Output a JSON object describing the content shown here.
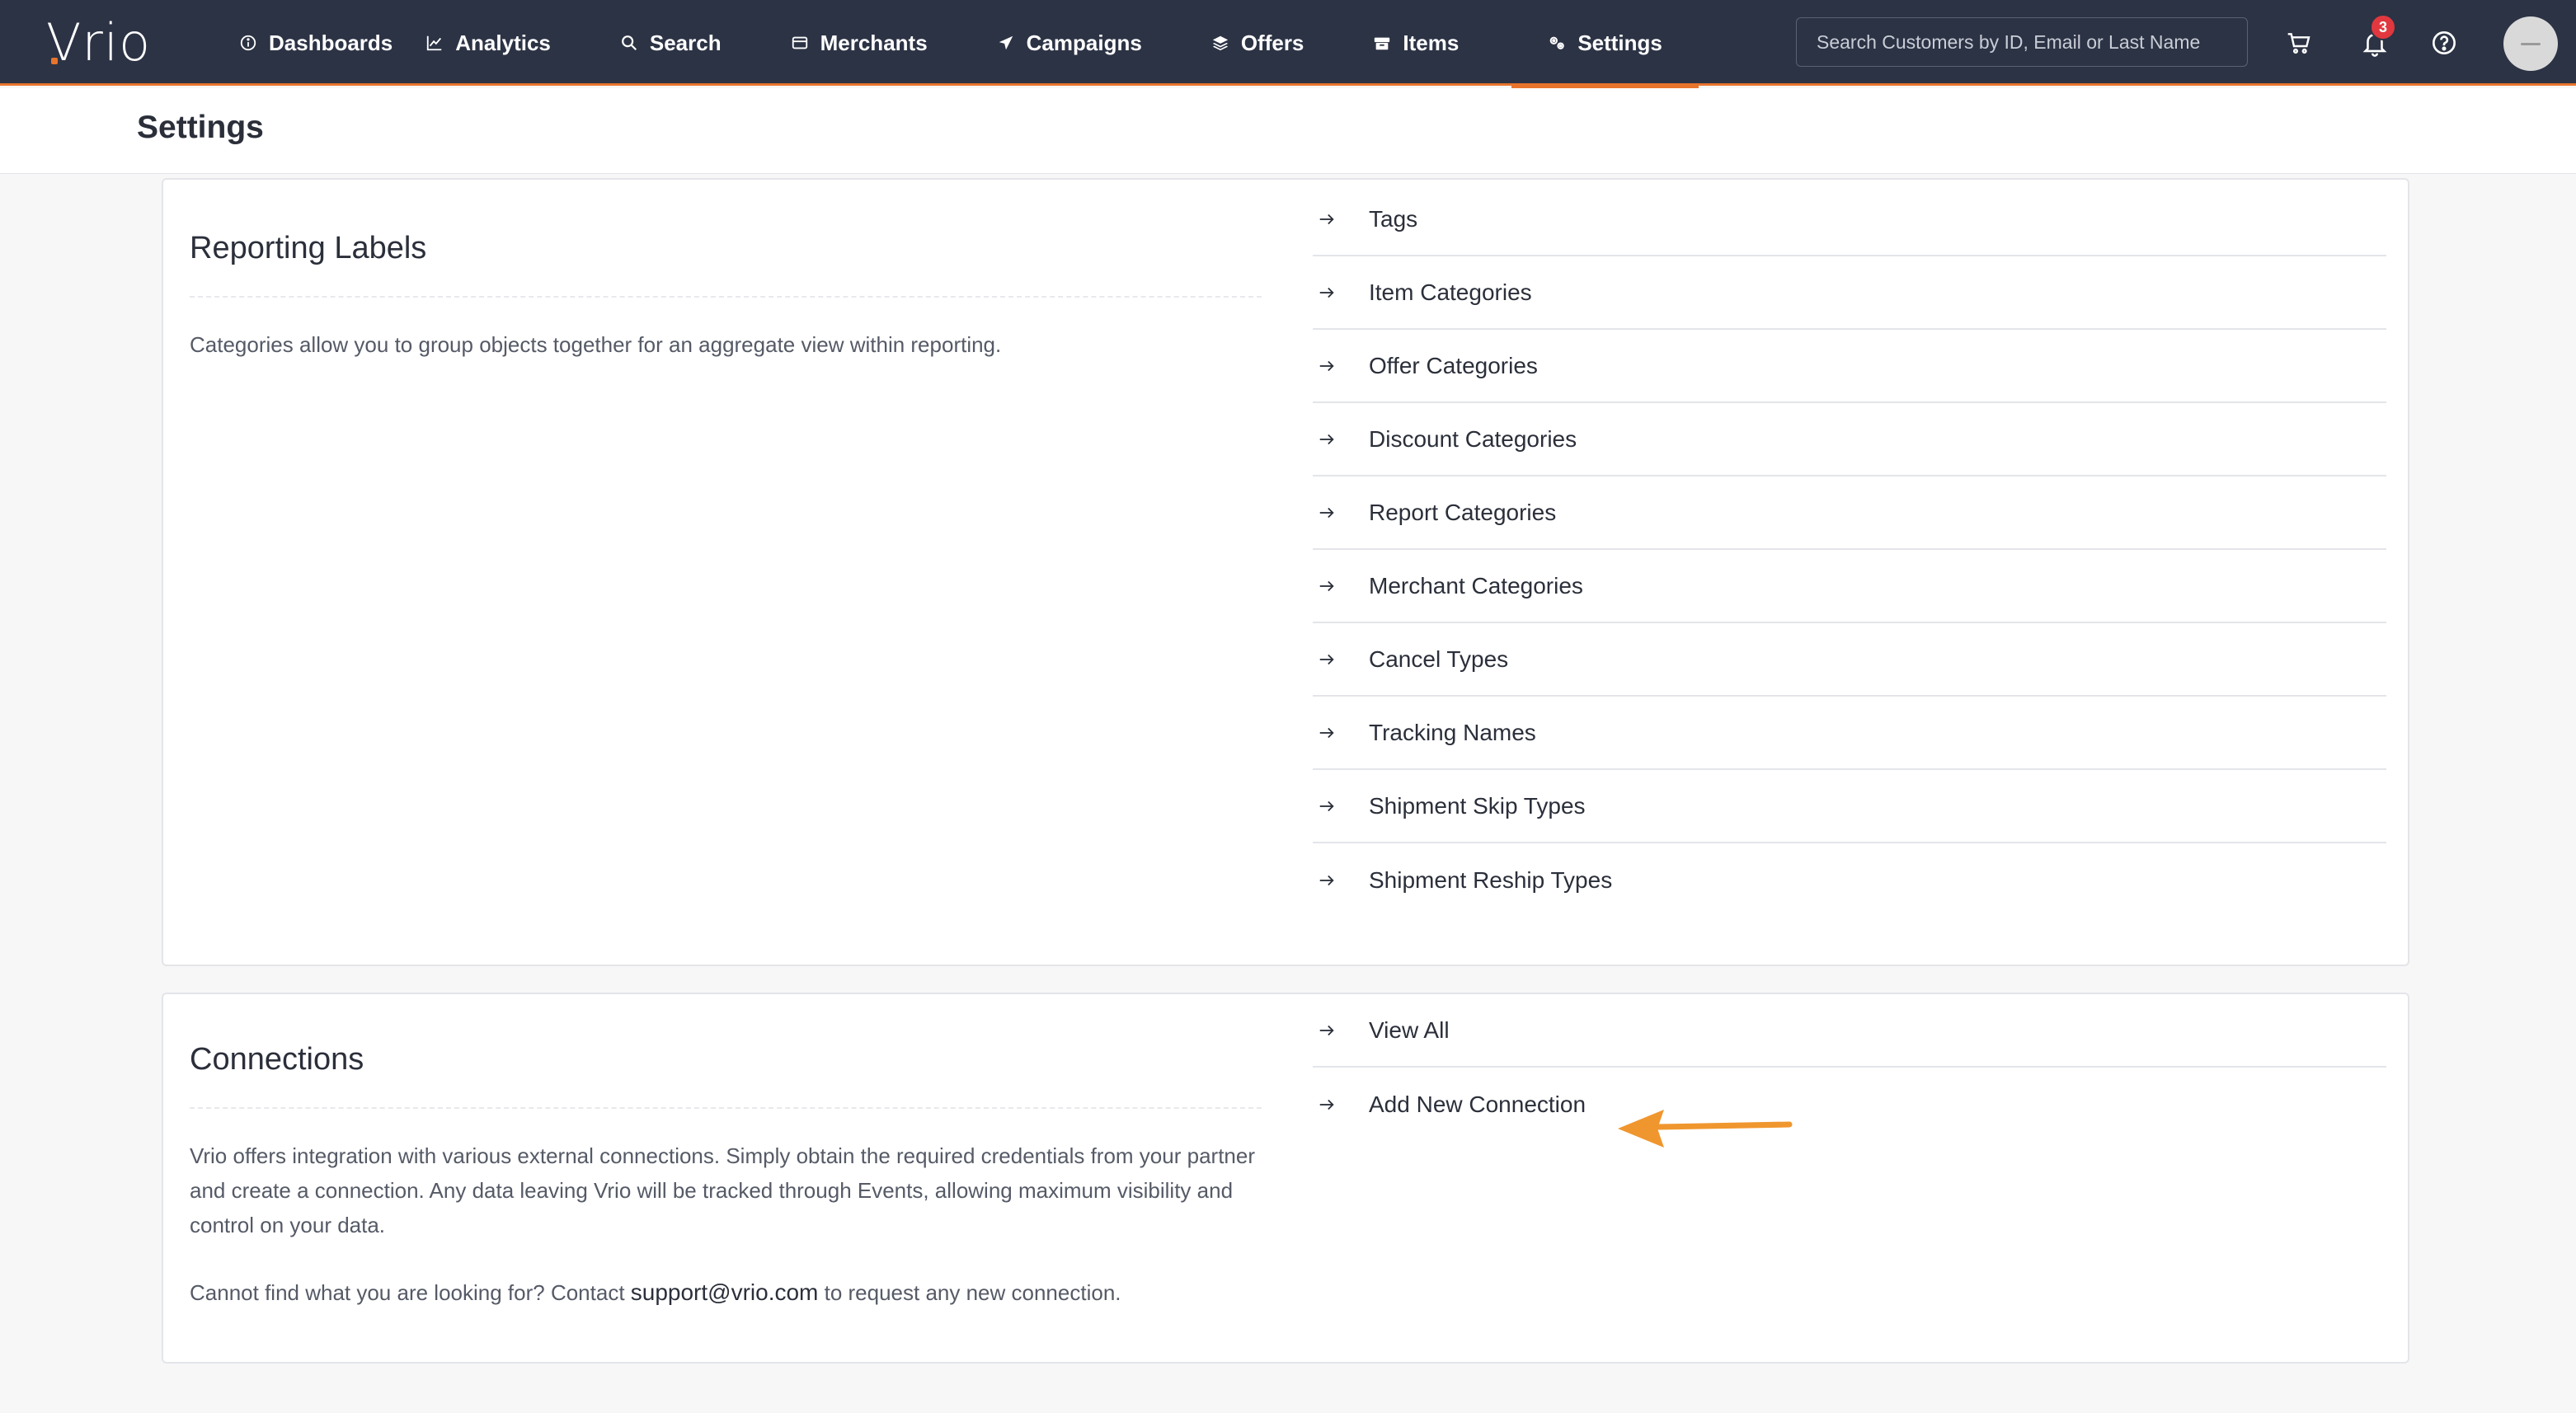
{
  "brand": {
    "logo_text": "Vrio",
    "accent": "#e8742c",
    "nav_bg": "#2c3345"
  },
  "nav": {
    "items": [
      {
        "label": "Dashboards",
        "icon": "info-circle-icon"
      },
      {
        "label": "Analytics",
        "icon": "line-chart-icon"
      },
      {
        "label": "Search",
        "icon": "search-icon"
      },
      {
        "label": "Merchants",
        "icon": "card-icon"
      },
      {
        "label": "Campaigns",
        "icon": "send-icon"
      },
      {
        "label": "Offers",
        "icon": "layers-icon"
      },
      {
        "label": "Items",
        "icon": "box-icon"
      },
      {
        "label": "Settings",
        "icon": "gears-icon",
        "active": true
      }
    ],
    "search_placeholder": "Search Customers by ID, Email or Last Name",
    "notification_count": "3"
  },
  "page": {
    "title": "Settings"
  },
  "reporting": {
    "title": "Reporting Labels",
    "description": "Categories allow you to group objects together for an aggregate view within reporting.",
    "links": [
      "Tags",
      "Item Categories",
      "Offer Categories",
      "Discount Categories",
      "Report Categories",
      "Merchant Categories",
      "Cancel Types",
      "Tracking Names",
      "Shipment Skip Types",
      "Shipment Reship Types"
    ]
  },
  "connections": {
    "title": "Connections",
    "description": "Vrio offers integration with various external connections. Simply obtain the required credentials from your partner and create a connection. Any data leaving Vrio will be tracked through Events, allowing maximum visibility and control on your data.",
    "contact_prefix": "Cannot find what you are looking for? Contact ",
    "contact_email": "support@vrio.com",
    "contact_suffix": " to request any new connection.",
    "links": [
      "View All",
      "Add New Connection"
    ]
  },
  "annotation": {
    "color": "#f0962e"
  }
}
